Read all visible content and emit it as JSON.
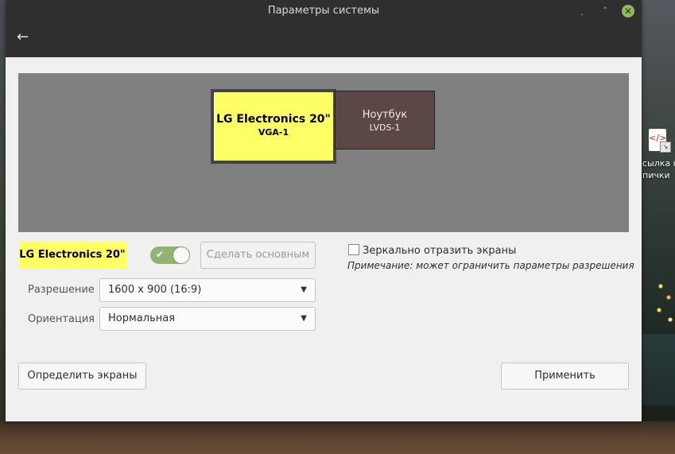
{
  "window": {
    "title": "Параметры системы",
    "back_icon": "←",
    "min_icon": "˯",
    "max_icon": "˄",
    "close_icon": "✕"
  },
  "monitors": [
    {
      "name": "LG Electronics 20\"",
      "connector": "VGA-1",
      "selected": true,
      "color": "#ffff66"
    },
    {
      "name": "Ноутбук",
      "connector": "LVDS-1",
      "selected": false,
      "color": "#5c4747"
    }
  ],
  "controls": {
    "selected_label": "LG Electronics 20\"",
    "enabled": true,
    "make_primary_label": "Сделать основным",
    "mirror_label": "Зеркально отразить экраны",
    "mirror_checked": false,
    "note": "Примечание: может ограничить параметры разрешения",
    "resolution_label": "Разрешение",
    "resolution_value": "1600 x 900 (16:9)",
    "orientation_label": "Ориентация",
    "orientation_value": "Нормальная",
    "detect_label": "Определить экраны",
    "apply_label": "Применить"
  },
  "desktop": {
    "icon_label_1": "сылка н",
    "icon_label_2": "пички"
  }
}
